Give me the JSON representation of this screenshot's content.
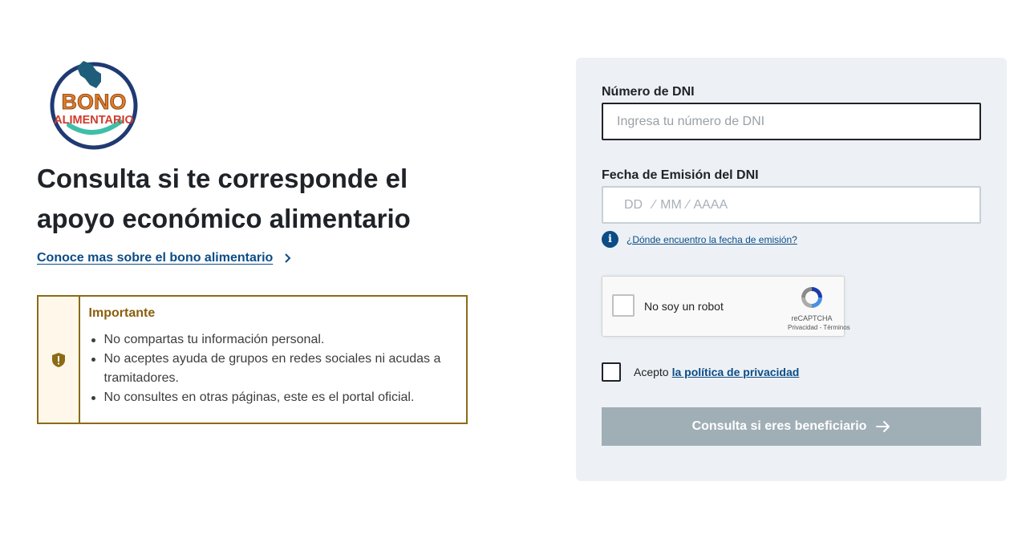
{
  "logo": {
    "line1": "BONO",
    "line2": "ALIMENTARIO"
  },
  "headline": "Consulta si te corresponde el apoyo económico alimentario",
  "learn_more": {
    "label": "Conoce mas sobre el bono alimentario"
  },
  "notice": {
    "title": "Importante",
    "items": [
      "No compartas tu información personal.",
      "No aceptes ayuda de grupos en redes sociales ni acudas a tramitadores.",
      "No consultes en otras páginas, este es el portal oficial."
    ]
  },
  "form": {
    "dni": {
      "label": "Número de DNI",
      "placeholder": "Ingresa tu número de DNI",
      "value": ""
    },
    "date": {
      "label": "Fecha de Emisión del DNI",
      "placeholder": "DD  ⁄ MM ⁄ AAAA",
      "value": ""
    },
    "help_link": "¿Dónde encuentro la fecha de emisión?",
    "captcha": {
      "label": "No soy un robot",
      "brand": "reCAPTCHA",
      "terms": "Privacidad - Términos"
    },
    "privacy": {
      "text": "Acepto",
      "link": "la política de privacidad"
    },
    "submit_label": "Consulta si eres beneficiario"
  },
  "colors": {
    "primary_link": "#0b4d86",
    "notice_border": "#8b6b16",
    "panel_bg": "#edf1f5",
    "submit_disabled": "#a0aeb6"
  }
}
